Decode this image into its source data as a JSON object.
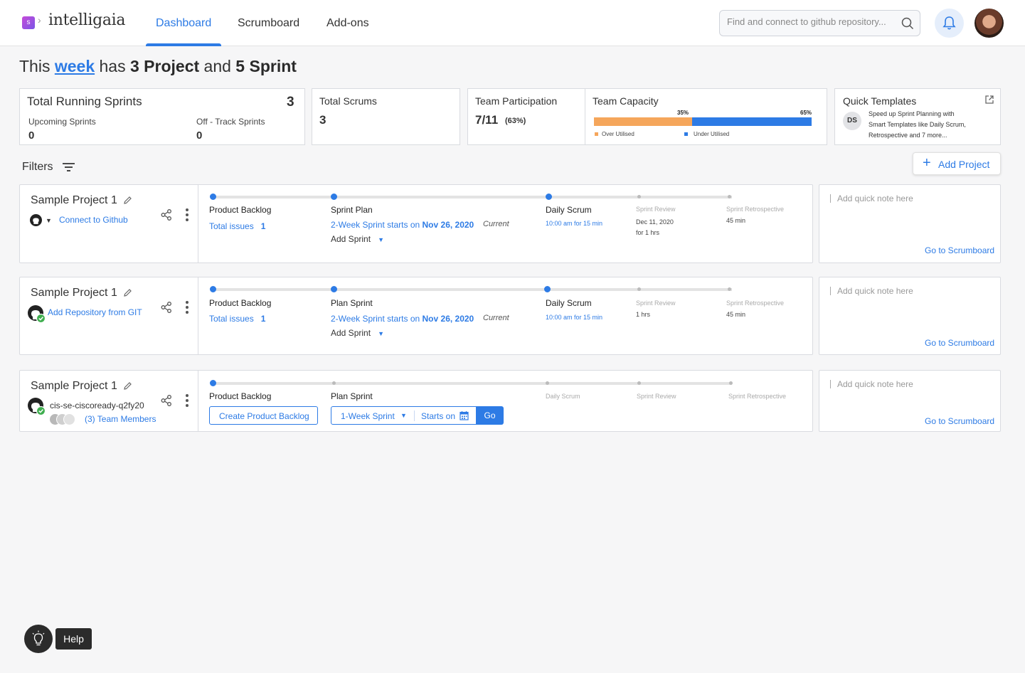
{
  "app": {
    "name": "intelligaia",
    "logo_letter": "s"
  },
  "nav": {
    "tabs": [
      "Dashboard",
      "Scrumboard",
      "Add-ons"
    ],
    "active": "Dashboard"
  },
  "search": {
    "placeholder": "Find and connect to github repository..."
  },
  "headline": {
    "prefix": "This",
    "week": "week",
    "has": "has",
    "projects": "3 Project",
    "and": "and",
    "sprints": "5 Sprint"
  },
  "stats": {
    "running": {
      "title": "Total Running Sprints",
      "count": "3",
      "upcoming_label": "Upcoming Sprints",
      "upcoming": "0",
      "offtrack_label": "Off - Track Sprints",
      "offtrack": "0"
    },
    "scrums": {
      "title": "Total Scrums",
      "count": "3"
    },
    "participation": {
      "title": "Team Participation",
      "value": "7/11",
      "pct": "(63%)"
    },
    "capacity": {
      "title": "Team Capacity",
      "over_pct": "35%",
      "under_pct": "65%",
      "over_label": "Over Utilised",
      "under_label": "Under Utilised",
      "over_color": "#f5a65b",
      "under_color": "#2d7be5"
    },
    "templates": {
      "title": "Quick Templates",
      "initials": "DS",
      "line1": "Speed up Sprint Planning with",
      "line2": "Smart Templates like Daily Scrum,",
      "line3": "Retrospective and 7 more..."
    }
  },
  "filters": {
    "label": "Filters",
    "add_project": "Add Project"
  },
  "projects": [
    {
      "name": "Sample Project 1",
      "repo_link": "Connect to Github",
      "stages": [
        "Product Backlog",
        "Sprint Plan",
        "Daily Scrum",
        "Sprint Review",
        "Sprint Retrospective"
      ],
      "issues_label": "Total issues",
      "issues": "1",
      "sprint_text": "2-Week Sprint starts on",
      "sprint_date": "Nov 26, 2020",
      "current": "Current",
      "add_sprint": "Add Sprint",
      "scrum_time": "10:00 am for 15 min",
      "review_date": "Dec 11, 2020",
      "review_dur": "for 1 hrs",
      "retro_dur": "45 min"
    },
    {
      "name": "Sample Project 1",
      "repo_link": "Add Repository from GIT",
      "stages": [
        "Product Backlog",
        "Plan Sprint",
        "Daily Scrum",
        "Sprint Review",
        "Sprint Retrospective"
      ],
      "issues_label": "Total issues",
      "issues": "1",
      "sprint_text": "2-Week Sprint starts on",
      "sprint_date": "Nov 26, 2020",
      "current": "Current",
      "add_sprint": "Add Sprint",
      "scrum_time": "10:00 am for 15 min",
      "review_dur": "1 hrs",
      "retro_dur": "45 min"
    },
    {
      "name": "Sample Project 1",
      "repo_name": "cis-se-ciscoready-q2fy20",
      "members": "(3) Team Members",
      "stages": [
        "Product Backlog",
        "Plan Sprint",
        "Daily Scrum",
        "Sprint Review",
        "Sprint Retrospective"
      ],
      "create_backlog": "Create Product Backlog",
      "sprint_select": "1-Week Sprint",
      "starts_on": "Starts on",
      "go": "Go"
    }
  ],
  "notes": {
    "placeholder": "Add quick note here",
    "link": "Go to Scrumboard"
  },
  "help": {
    "label": "Help"
  }
}
